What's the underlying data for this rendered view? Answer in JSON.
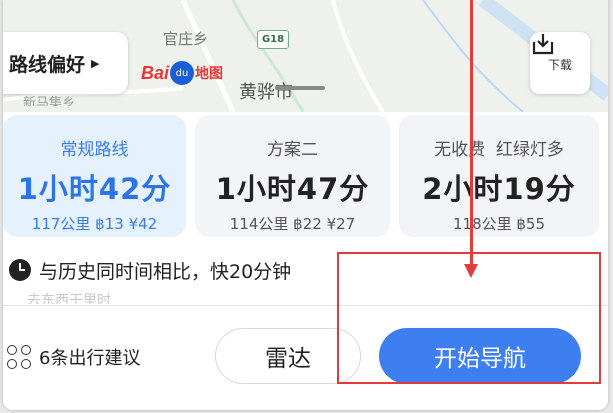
{
  "map": {
    "labels": [
      "官庄乡",
      "黄骅市",
      "新马集乡"
    ],
    "road_shield": "G18",
    "route_preference": {
      "label": "路线偏好",
      "arrow": "▶"
    },
    "logo": {
      "bai": "Bai",
      "du": "du",
      "map_word": "地图"
    },
    "download": {
      "label": "下载",
      "icon": "download-icon"
    }
  },
  "routes": [
    {
      "name": "常规路线",
      "duration": "1小时42分",
      "meta": "117公里 ฿13 ¥42",
      "selected": true
    },
    {
      "name": "方案二",
      "duration": "1小时47分",
      "meta": "114公里 ฿22 ¥27",
      "selected": false
    },
    {
      "name": "无收费  红绿灯多",
      "duration": "2小时19分",
      "meta": "118公里 ฿55",
      "selected": false
    }
  ],
  "info": {
    "comparison": "与历史同时间相比，快20分钟",
    "secondary": "去东西干里时"
  },
  "bottom": {
    "suggestions": "6条出行建议",
    "radar": "雷达",
    "navigate": "开始导航"
  },
  "colors": {
    "accent": "#3d7ef0",
    "annotation": "#e23b3b",
    "selected_card_bg": "#e6f1fe"
  }
}
